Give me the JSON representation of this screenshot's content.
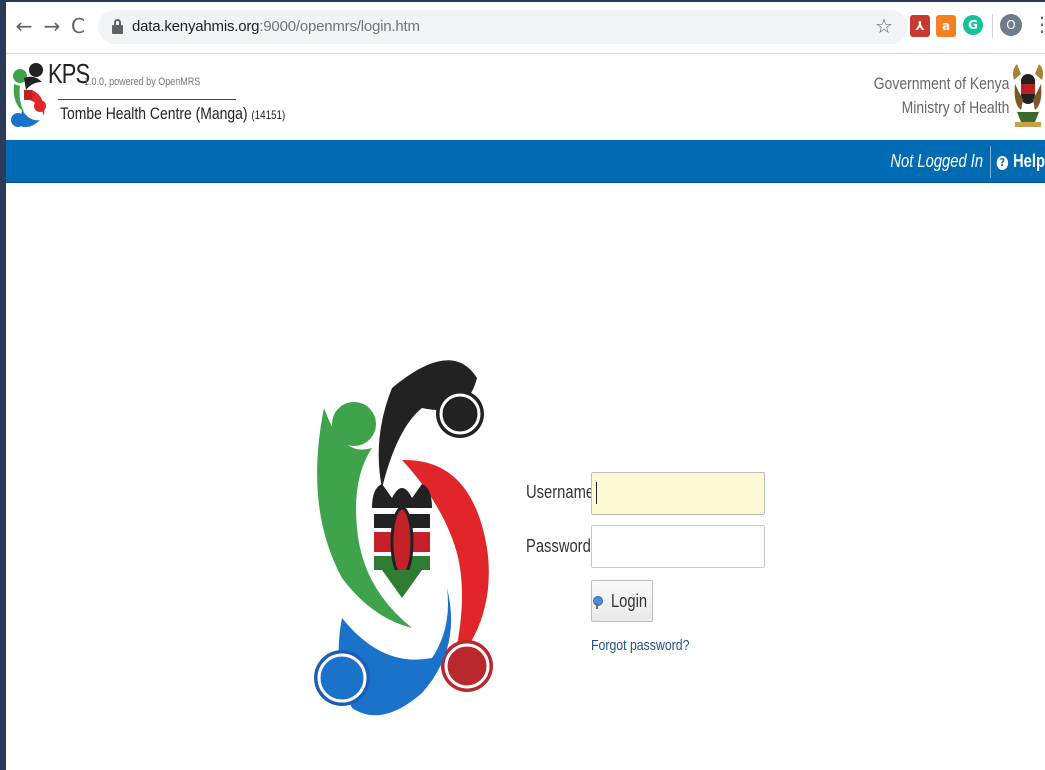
{
  "browser": {
    "back_glyph": "←",
    "forward_glyph": "→",
    "reload_glyph": "C",
    "url_host": "data.kenyahmis.org",
    "url_rest": ":9000/openmrs/login.htm",
    "bookmark_glyph": "☆",
    "extensions": [
      {
        "name": "pdf-extension-icon",
        "glyph": "⅄"
      },
      {
        "name": "honey-extension-icon",
        "glyph": "a"
      },
      {
        "name": "grammarly-extension-icon",
        "glyph": "G"
      }
    ],
    "profile_initial": "O",
    "menu_glyph": "⋮"
  },
  "header": {
    "app_name": "KPS",
    "version": "1.0.0, powered by OpenMRS",
    "facility_name": "Tombe Health Centre (Manga)",
    "facility_code": "(14151)",
    "gov_line1": "Government of Kenya",
    "gov_line2": "Ministry of Health"
  },
  "topbar": {
    "status": "Not Logged In",
    "help_label": "Help",
    "help_icon": "?"
  },
  "login": {
    "username_label": "Username",
    "username_value": "",
    "password_label": "Password",
    "password_value": "",
    "login_button": "Login",
    "forgot_password": "Forgot password?"
  },
  "colors": {
    "brand_blue": "#006bb3",
    "username_field_bg": "#fdfbd6",
    "logo_green": "#3ea34a",
    "logo_black": "#222222",
    "logo_red": "#e0262b",
    "logo_blue": "#1a73c9"
  }
}
